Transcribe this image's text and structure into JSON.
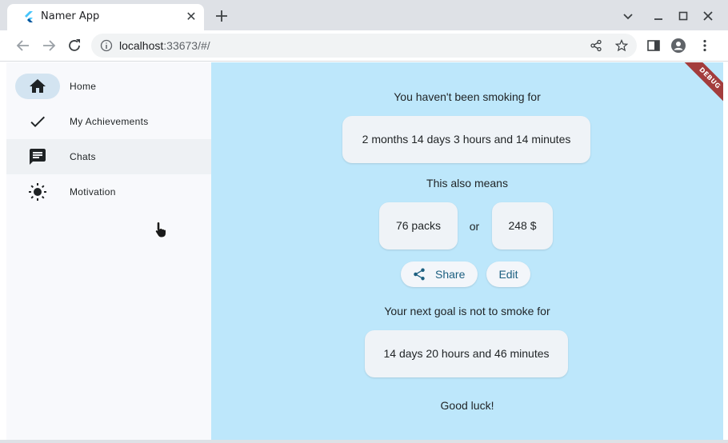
{
  "browser": {
    "tab_title": "Namer App",
    "url_host": "localhost",
    "url_rest": ":33673/#/"
  },
  "sidebar": {
    "items": [
      {
        "label": "Home",
        "icon": "home-icon",
        "selected": true
      },
      {
        "label": "My Achievements",
        "icon": "check-icon",
        "selected": false
      },
      {
        "label": "Chats",
        "icon": "chat-icon",
        "selected": false
      },
      {
        "label": "Motivation",
        "icon": "sun-icon",
        "selected": false
      }
    ]
  },
  "main": {
    "heading": "You haven't been smoking for",
    "duration": "2 months 14 days 3 hours and 14 minutes",
    "also_means": "This also means",
    "packs": "76 packs",
    "or_text": "or",
    "money": "248 $",
    "share_label": "Share",
    "edit_label": "Edit",
    "next_goal_text": "Your next goal is not to smoke for",
    "next_goal_duration": "14 days 20 hours and 46 minutes",
    "good_luck": "Good luck!",
    "debug_banner": "DEBUG"
  },
  "colors": {
    "content_bg": "#bde7fb",
    "sidebar_bg": "#f8f9fc",
    "accent": "#1c5f80",
    "selected_indicator": "#d3e4f1"
  }
}
